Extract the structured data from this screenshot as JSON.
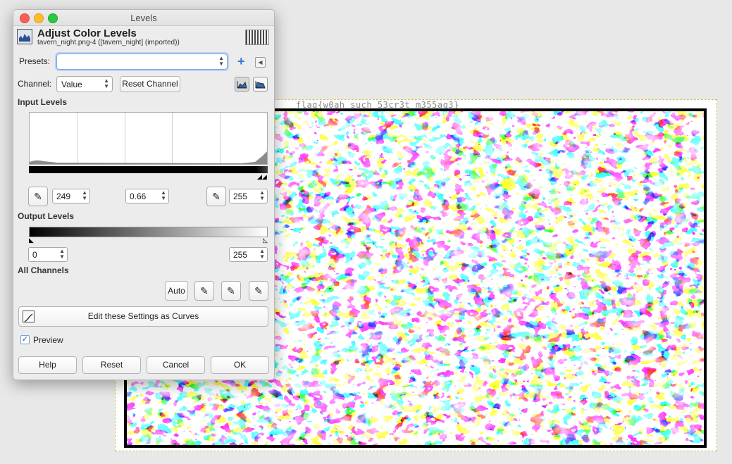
{
  "canvas": {
    "flag_text": "flag{w0ah_such_53cr3t_m355aq3}"
  },
  "dialog": {
    "title": "Levels",
    "header_title": "Adjust Color Levels",
    "header_subtitle": "tavern_night.png-4 ([tavern_night] (imported))",
    "presets_label": "Presets:",
    "presets_value": "",
    "channel_label": "Channel:",
    "channel_value": "Value",
    "reset_channel_label": "Reset Channel",
    "input_levels_label": "Input Levels",
    "input_low": "249",
    "input_gamma": "0.66",
    "input_high": "255",
    "output_levels_label": "Output Levels",
    "output_low": "0",
    "output_high": "255",
    "all_channels_label": "All Channels",
    "auto_label": "Auto",
    "curves_label": "Edit these Settings as Curves",
    "preview_label": "Preview",
    "preview_checked": true,
    "help_label": "Help",
    "reset_label": "Reset",
    "cancel_label": "Cancel",
    "ok_label": "OK"
  },
  "icons": {
    "close": "close-traffic-light",
    "minimize": "minimize-traffic-light",
    "maximize": "maximize-traffic-light",
    "levels": "levels-icon",
    "add_preset": "plus-icon",
    "preset_menu": "triangle-left-icon",
    "linear_histogram": "linear-histogram-icon",
    "log_histogram": "log-histogram-icon",
    "black_picker": "eyedropper-icon",
    "gray_picker": "eyedropper-icon",
    "white_picker": "eyedropper-icon",
    "curves": "curves-icon"
  },
  "colors": {
    "close": "#fc5f57",
    "minimize": "#fdbc2e",
    "maximize": "#28c840",
    "accent": "#2d78d6"
  }
}
